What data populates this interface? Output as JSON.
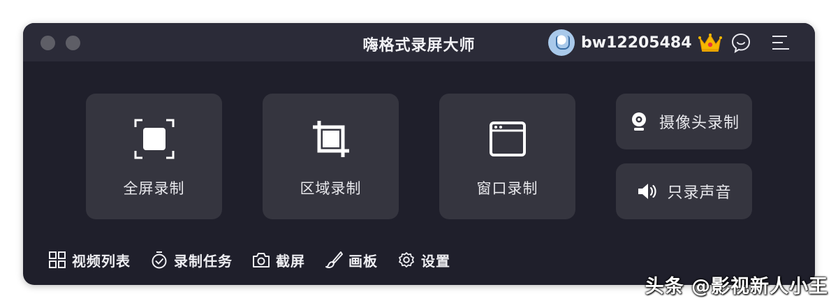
{
  "window": {
    "title": "嗨格式录屏大师"
  },
  "header": {
    "username": "bw12205484",
    "vip_icon": "crown-icon",
    "feedback_icon": "chat-bubble-icon",
    "menu_icon": "hamburger-menu-icon"
  },
  "modes": [
    {
      "label": "全屏录制",
      "icon": "fullscreen-icon"
    },
    {
      "label": "区域录制",
      "icon": "crop-icon"
    },
    {
      "label": "窗口录制",
      "icon": "window-icon"
    },
    {
      "label": "摄像头录制",
      "icon": "webcam-icon"
    },
    {
      "label": "只录声音",
      "icon": "speaker-icon"
    }
  ],
  "bottom_nav": [
    {
      "label": "视频列表",
      "icon": "grid-icon"
    },
    {
      "label": "录制任务",
      "icon": "timer-check-icon"
    },
    {
      "label": "截屏",
      "icon": "camera-icon"
    },
    {
      "label": "画板",
      "icon": "brush-icon"
    },
    {
      "label": "设置",
      "icon": "gear-icon"
    }
  ],
  "watermark": "头条 @影视新人小王",
  "colors": {
    "window_bg": "#1f1f2b",
    "titlebar_bg": "#2b2b38",
    "card_bg": "#35353f",
    "crown": "#f5b800"
  }
}
